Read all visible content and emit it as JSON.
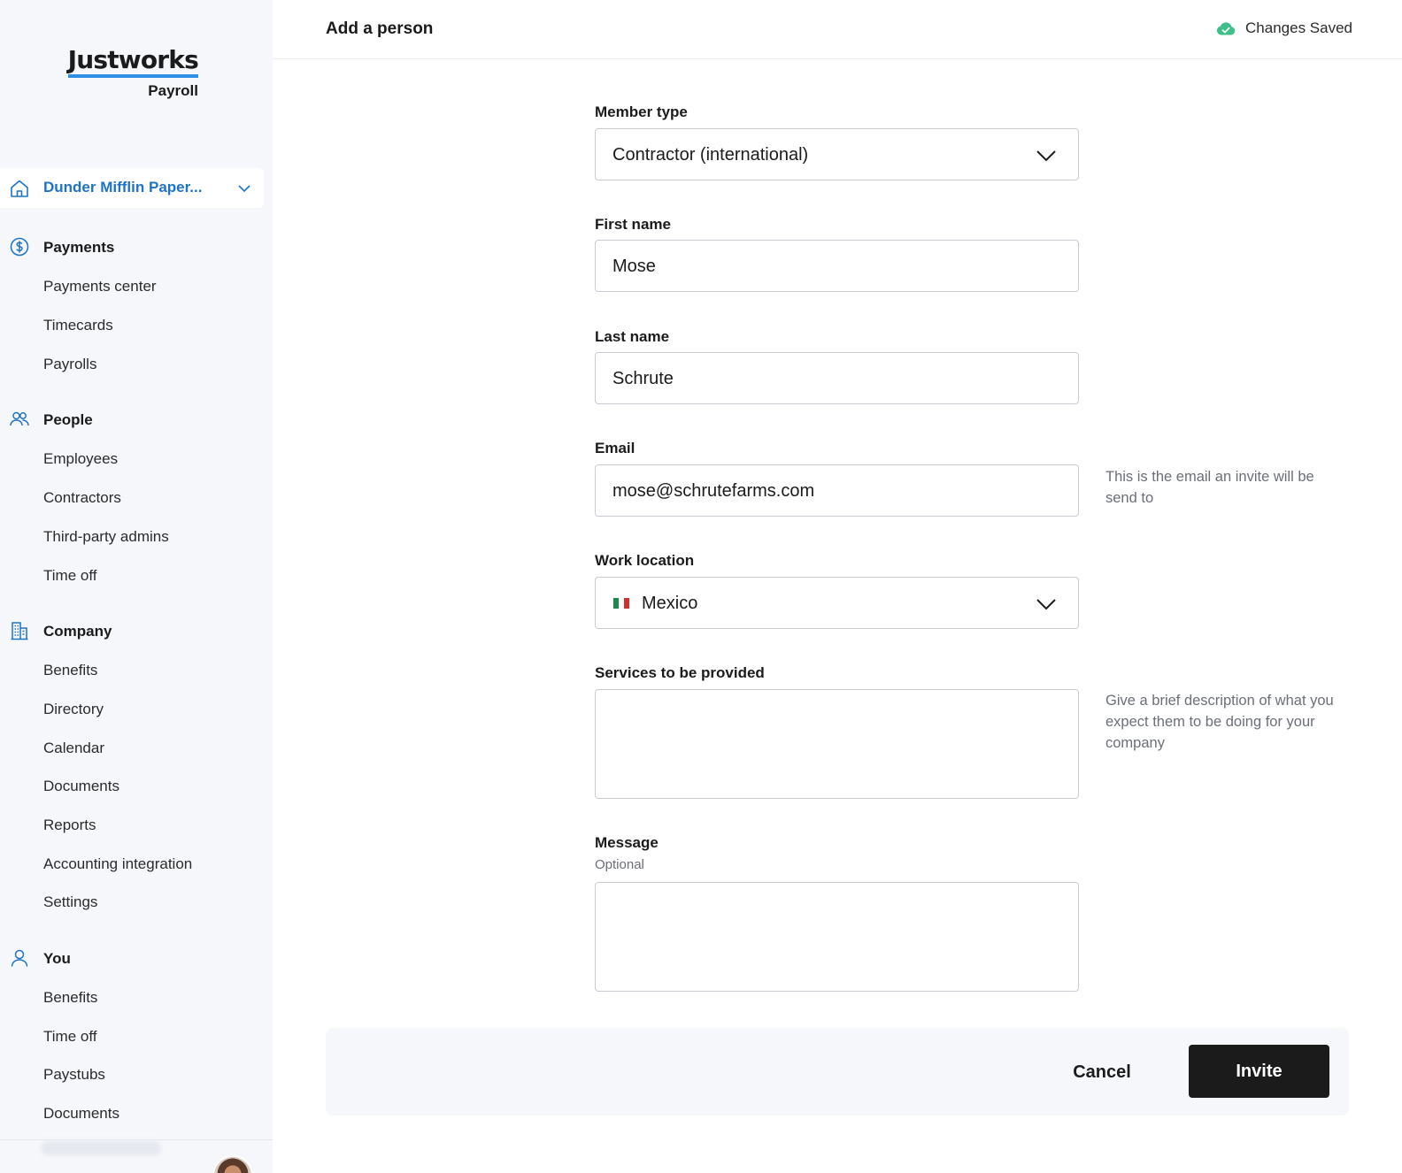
{
  "brand": {
    "name": "Justworks",
    "product": "Payroll"
  },
  "sidebar": {
    "company": "Dunder Mifflin Paper...",
    "sections": [
      {
        "label": "Payments",
        "icon": "dollar-circle-icon",
        "items": [
          "Payments center",
          "Timecards",
          "Payrolls"
        ]
      },
      {
        "label": "People",
        "icon": "people-icon",
        "items": [
          "Employees",
          "Contractors",
          "Third-party admins",
          "Time off"
        ]
      },
      {
        "label": "Company",
        "icon": "building-icon",
        "items": [
          "Benefits",
          "Directory",
          "Calendar",
          "Documents",
          "Reports",
          "Accounting integration",
          "Settings"
        ]
      },
      {
        "label": "You",
        "icon": "user-icon",
        "items": [
          "Benefits",
          "Time off",
          "Paystubs",
          "Documents"
        ]
      }
    ]
  },
  "header": {
    "title": "Add a person",
    "status": "Changes Saved"
  },
  "form": {
    "member_type": {
      "label": "Member type",
      "value": "Contractor (international)"
    },
    "first_name": {
      "label": "First name",
      "value": "Mose"
    },
    "last_name": {
      "label": "Last name",
      "value": "Schrute"
    },
    "email": {
      "label": "Email",
      "value": "mose@schrutefarms.com",
      "hint": "This is the email an invite will be send to"
    },
    "work_location": {
      "label": "Work location",
      "value": "Mexico"
    },
    "services": {
      "label": "Services to be provided",
      "value": "",
      "hint": "Give a brief description of what you expect them to be doing for your company"
    },
    "message": {
      "label": "Message",
      "sublabel": "Optional",
      "value": ""
    }
  },
  "actions": {
    "cancel": "Cancel",
    "invite": "Invite"
  },
  "colors": {
    "accent": "#1f73c7",
    "logo_underline": "#2f8fe6",
    "saved_icon": "#3dbf8a",
    "primary_button": "#1b1b1b"
  }
}
